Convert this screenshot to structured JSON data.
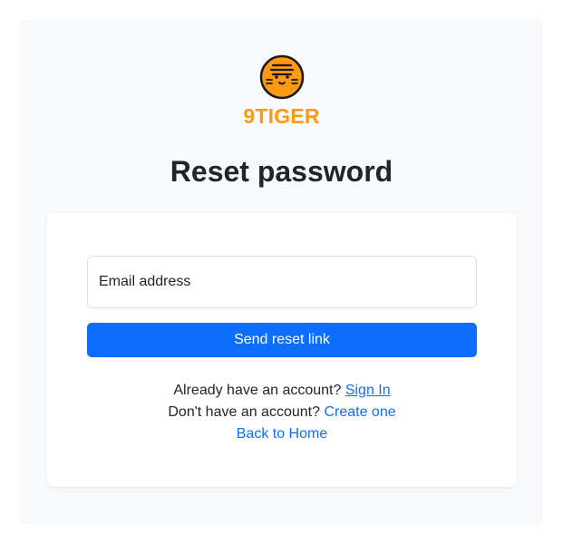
{
  "brand": {
    "name": "9TIGER",
    "color": "#fd9a12"
  },
  "page": {
    "title": "Reset password"
  },
  "form": {
    "email_placeholder": "Email address",
    "submit_label": "Send reset link",
    "accent_color": "#0d6efd"
  },
  "links": {
    "signin_prompt": "Already have an account?",
    "signin_label": "Sign In",
    "signup_prompt": "Don't have an account?",
    "signup_label": "Create one",
    "home_label": "Back to Home"
  },
  "icons": {
    "logo": "tiger-face-icon"
  }
}
